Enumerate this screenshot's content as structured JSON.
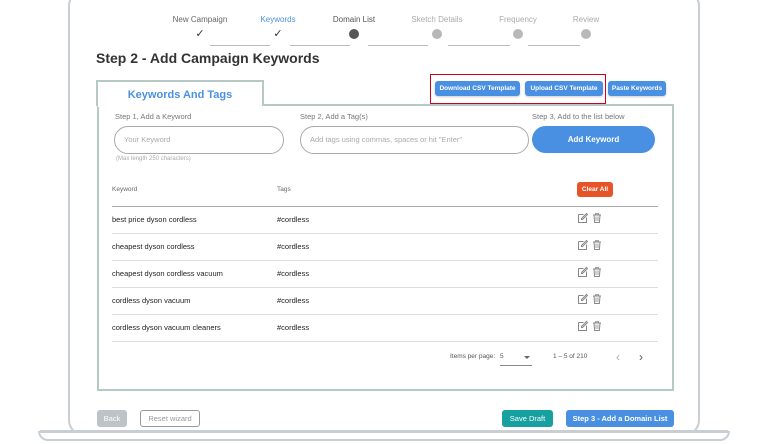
{
  "stepper": {
    "steps": [
      {
        "label": "New Campaign",
        "state": "done"
      },
      {
        "label": "Keywords",
        "state": "active"
      },
      {
        "label": "Domain List",
        "state": "current"
      },
      {
        "label": "Sketch Details",
        "state": "todo"
      },
      {
        "label": "Frequency",
        "state": "todo"
      },
      {
        "label": "Review",
        "state": "todo"
      }
    ],
    "check_glyph": "✓"
  },
  "page": {
    "title": "Step 2 - Add Campaign Keywords"
  },
  "panel": {
    "tab_label": "Keywords And Tags",
    "toolbar": {
      "download_csv": "Download CSV Template",
      "upload_csv": "Upload CSV Template",
      "paste_keywords": "Paste Keywords"
    },
    "form": {
      "step1_label": "Step 1, Add a Keyword",
      "step2_label": "Step 2, Add a Tag(s)",
      "step3_label": "Step 3, Add to the list below",
      "keyword_placeholder": "Your Keyword",
      "tags_placeholder": "Add tags using commas, spaces or hit \"Enter\"",
      "max_length_note": "(Max length 250 characters)",
      "add_button": "Add Keyword"
    },
    "table": {
      "col_keyword": "Keyword",
      "col_tags": "Tags",
      "clear_all": "Clear All",
      "rows": [
        {
          "keyword": "best price dyson cordless",
          "tags": "#cordless"
        },
        {
          "keyword": "cheapest dyson cordless",
          "tags": "#cordless"
        },
        {
          "keyword": "cheapest dyson cordless vacuum",
          "tags": "#cordless"
        },
        {
          "keyword": "cordless dyson vacuum",
          "tags": "#cordless"
        },
        {
          "keyword": "cordless dyson vacuum cleaners",
          "tags": "#cordless"
        }
      ]
    },
    "pagination": {
      "items_per_page_label": "Items per page:",
      "items_per_page": "5",
      "range": "1 – 5 of 210",
      "prev": "‹",
      "next": "›"
    }
  },
  "footer": {
    "back": "Back",
    "reset": "Reset wizard",
    "save_draft": "Save Draft",
    "next": "Step 3 - Add a Domain List"
  },
  "colors": {
    "accent": "#4a90e2",
    "danger": "#e8542a",
    "teal": "#16a0a0",
    "highlight_box": "#d0021b",
    "panel_border": "#b7c9c6"
  },
  "icons": {
    "edit": "edit-icon",
    "delete": "trash-icon"
  }
}
